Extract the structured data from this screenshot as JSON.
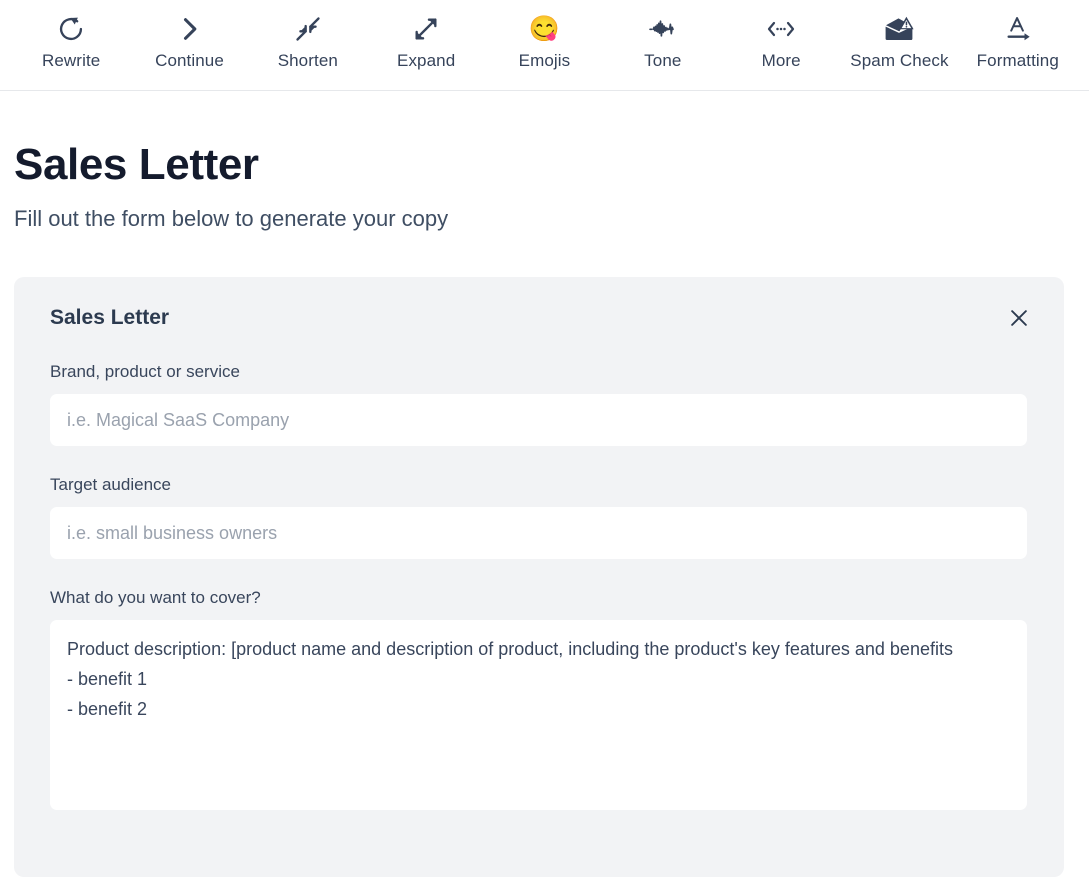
{
  "toolbar": {
    "items": [
      {
        "label": "Rewrite",
        "icon": "rotate-ccw-icon"
      },
      {
        "label": "Continue",
        "icon": "chevron-right-icon"
      },
      {
        "label": "Shorten",
        "icon": "arrows-collapse-icon"
      },
      {
        "label": "Expand",
        "icon": "arrows-expand-icon"
      },
      {
        "label": "Emojis",
        "icon": "smiling-face-with-tongue-emoji",
        "glyph": "😋"
      },
      {
        "label": "Tone",
        "icon": "waveform-icon"
      },
      {
        "label": "More",
        "icon": "code-ellipsis-icon"
      },
      {
        "label": "Spam Check",
        "icon": "envelope-warning-icon"
      },
      {
        "label": "Formatting",
        "icon": "letter-a-arrow-icon"
      }
    ]
  },
  "page": {
    "title": "Sales Letter",
    "subtitle": "Fill out the form below to generate your copy"
  },
  "form_card": {
    "title": "Sales Letter",
    "close_label": "×",
    "fields": {
      "brand": {
        "label": "Brand, product or service",
        "placeholder": "i.e. Magical SaaS Company",
        "value": ""
      },
      "audience": {
        "label": "Target audience",
        "placeholder": "i.e. small business owners",
        "value": ""
      },
      "cover": {
        "label": "What do you want to cover?",
        "placeholder": "",
        "value": "Product description: [product name and description of product, including the product's key features and benefits\n- benefit 1\n- benefit 2"
      }
    }
  },
  "colors": {
    "page_background": "#ffffff",
    "card_background": "#f2f3f5",
    "input_background": "#ffffff",
    "text_primary": "#141b2d",
    "text_secondary": "#39465c",
    "icon": "#36435a",
    "toolbar_border": "#e6e8eb",
    "placeholder": "#9aa2ae"
  }
}
